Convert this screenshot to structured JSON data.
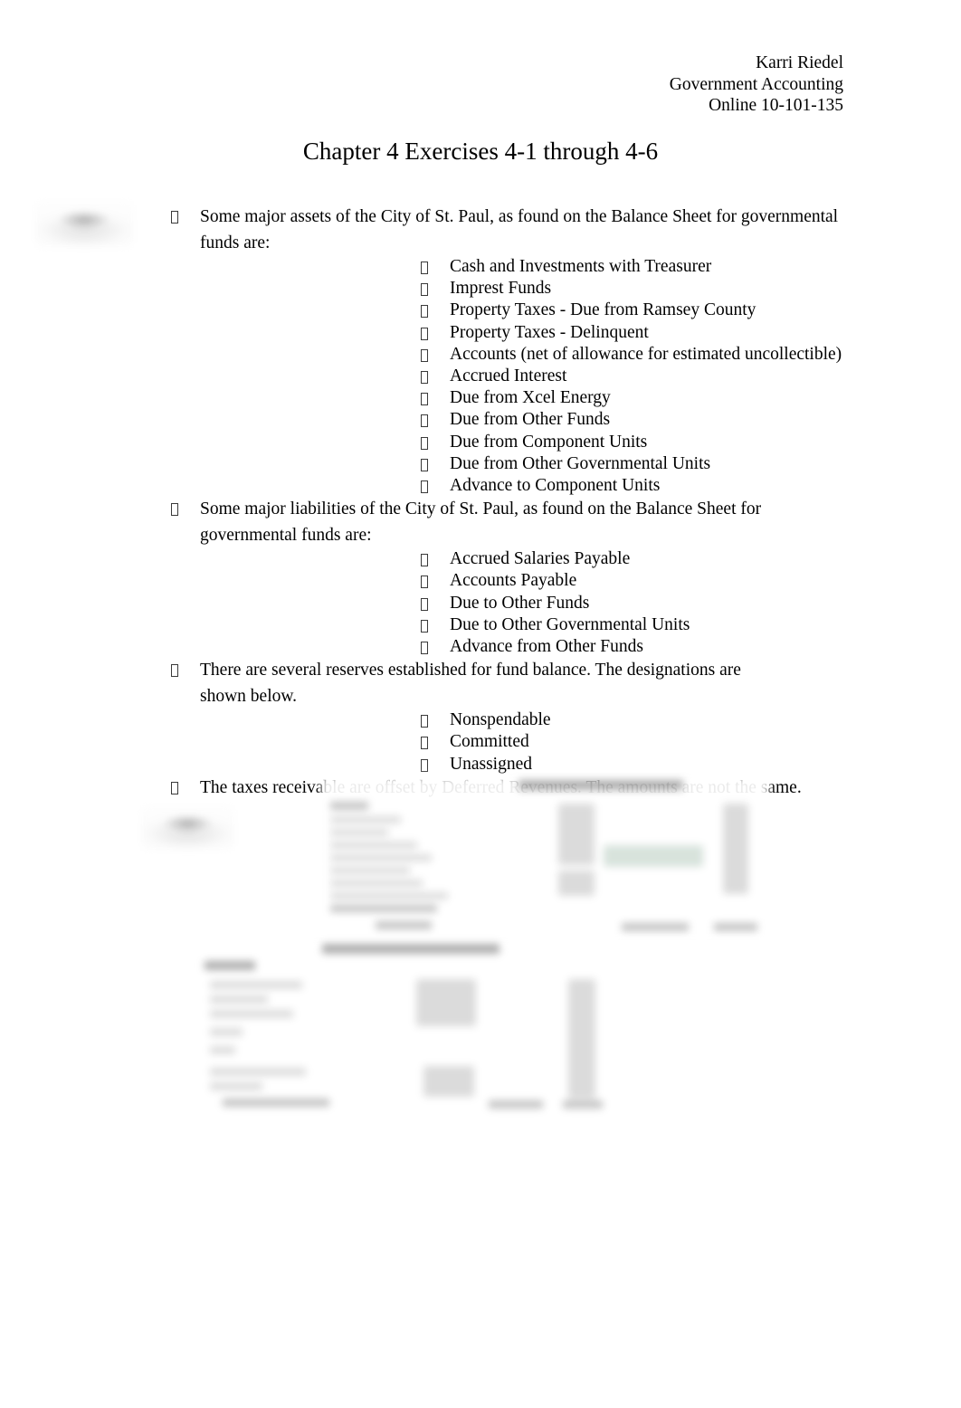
{
  "document": {
    "header": {
      "author": "Karri Riedel",
      "course": "Government Accounting",
      "section": "Online 10-101-135"
    },
    "title": "Chapter 4 Exercises 4-1 through 4-6",
    "bullets": [
      {
        "text": "Some major assets of the City of St. Paul, as found on the Balance Sheet for governmental funds are:",
        "children": [
          "Cash and Investments with Treasurer",
          "Imprest Funds",
          "Property Taxes - Due from Ramsey County",
          "Property Taxes - Delinquent",
          "Accounts (net of allowance for estimated uncollectible)",
          "Accrued Interest",
          "Due from Xcel Energy",
          "Due from Other Funds",
          "Due from Component Units",
          "Due from Other Governmental Units",
          "Advance to Component Units"
        ]
      },
      {
        "text": "Some major liabilities of the City of St. Paul, as found on the Balance Sheet for governmental funds are:",
        "children": [
          "Accrued Salaries Payable",
          "Accounts Payable",
          "Due to Other Funds",
          "Due to Other Governmental Units",
          "Advance from Other Funds"
        ]
      },
      {
        "text": "There are several reserves established for fund balance. The designations are shown below.",
        "children": [
          "Nonspendable",
          "Committed",
          "Unassigned"
        ]
      },
      {
        "text": "The taxes receivable are offset by Deferred Revenues. The amounts are not the same.",
        "children": []
      }
    ],
    "embedded_graphics": [
      {
        "name": "margin-badge-top",
        "caption": ""
      },
      {
        "name": "margin-badge-lower",
        "caption": ""
      },
      {
        "name": "balance-sheet-assets-screenshot",
        "caption": ""
      },
      {
        "name": "balance-sheet-liabilities-screenshot",
        "caption": ""
      }
    ],
    "colors": {
      "page_background": "#ffffff",
      "text": "#000000",
      "highlight_band": "#cedcd4"
    }
  }
}
